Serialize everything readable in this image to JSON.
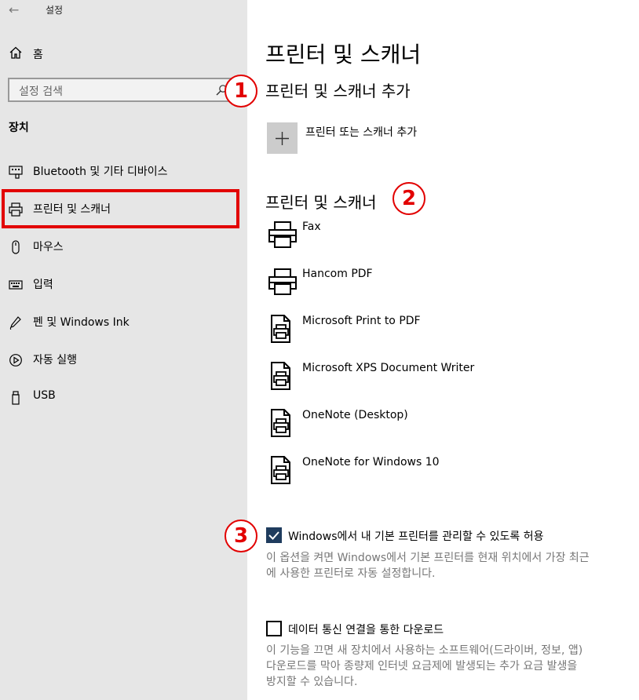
{
  "window": {
    "title": "설정"
  },
  "sidebar": {
    "home_label": "홈",
    "search_placeholder": "설정 검색",
    "section_title": "장치",
    "items": [
      {
        "label": "Bluetooth 및 기타 디바이스",
        "icon": "bluetooth-devices-icon"
      },
      {
        "label": "프린터 및 스캐너",
        "icon": "printer-icon",
        "selected": true
      },
      {
        "label": "마우스",
        "icon": "mouse-icon"
      },
      {
        "label": "입력",
        "icon": "keyboard-icon"
      },
      {
        "label": "펜 및 Windows Ink",
        "icon": "pen-icon"
      },
      {
        "label": "자동 실행",
        "icon": "autoplay-icon"
      },
      {
        "label": "USB",
        "icon": "usb-icon"
      }
    ]
  },
  "main": {
    "page_title": "프린터 및 스캐너",
    "add_section_title": "프린터 및 스캐너 추가",
    "add_button_label": "프린터 또는 스캐너 추가",
    "list_section_title": "프린터 및 스캐너",
    "printers": [
      {
        "name": "Fax",
        "icon": "printer-icon"
      },
      {
        "name": "Hancom PDF",
        "icon": "printer-icon"
      },
      {
        "name": "Microsoft Print to PDF",
        "icon": "document-printer-icon"
      },
      {
        "name": "Microsoft XPS Document Writer",
        "icon": "document-printer-icon"
      },
      {
        "name": "OneNote (Desktop)",
        "icon": "document-printer-icon"
      },
      {
        "name": "OneNote for Windows 10",
        "icon": "document-printer-icon"
      }
    ],
    "default_printer": {
      "checked": true,
      "label": "Windows에서 내 기본 프린터를 관리할 수 있도록 허용",
      "desc_line1": "이 옵션을 켜면 Windows에서 기본 프린터를 현재 위치에서 가장 최근",
      "desc_line2": "에 사용한 프린터로 자동 설정합니다."
    },
    "metered_download": {
      "checked": false,
      "label": "데이터 통신 연결을 통한 다운로드",
      "desc_line1": "이 기능을 끄면 새 장치에서 사용하는 소프트웨어(드라이버, 정보, 앱)",
      "desc_line2": "다운로드를 막아 종량제 인터넷 요금제에 발생되는 추가 요금 발생을",
      "desc_line3": "방지할 수 있습니다."
    }
  },
  "annotations": {
    "marker1": "1",
    "marker2": "2",
    "marker3": "3"
  },
  "colors": {
    "sidebar_bg": "#e6e6e6",
    "highlight_red": "#e20000",
    "checkbox_accent": "#1f3c5e"
  }
}
